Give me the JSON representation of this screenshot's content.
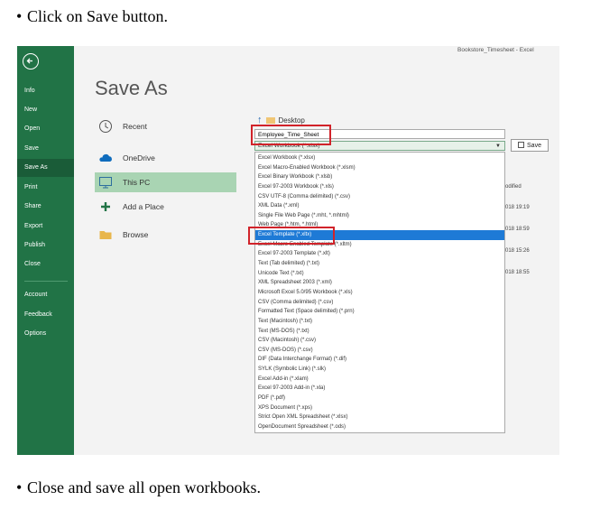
{
  "instructions": {
    "top": "Click on Save button.",
    "bottom": "Close and save all open workbooks.",
    "bullet": "•"
  },
  "window_title": "Bookstore_Timesheet  -  Excel",
  "sidebar": {
    "items": [
      {
        "label": "Info"
      },
      {
        "label": "New"
      },
      {
        "label": "Open"
      },
      {
        "label": "Save"
      },
      {
        "label": "Save As",
        "active": true
      },
      {
        "label": "Print"
      },
      {
        "label": "Share"
      },
      {
        "label": "Export"
      },
      {
        "label": "Publish"
      },
      {
        "label": "Close"
      },
      {
        "label": "Account"
      },
      {
        "label": "Feedback"
      },
      {
        "label": "Options"
      }
    ]
  },
  "page_title": "Save As",
  "locations": [
    {
      "label": "Recent",
      "icon": "clock-icon"
    },
    {
      "label": "OneDrive",
      "icon": "cloud-icon"
    },
    {
      "label": "This PC",
      "icon": "computer-icon",
      "selected": true
    },
    {
      "label": "Add a Place",
      "icon": "plus-icon"
    },
    {
      "label": "Browse",
      "icon": "folder-icon"
    }
  ],
  "path": {
    "label": "Desktop"
  },
  "filename_value": "Employee_Time_Sheet",
  "filetype_selected": "Excel Workbook (*.xlsx)",
  "save_button": "Save",
  "file_types": [
    "Excel Workbook (*.xlsx)",
    "Excel Macro-Enabled Workbook (*.xlsm)",
    "Excel Binary Workbook (*.xlsb)",
    "Excel 97-2003 Workbook (*.xls)",
    "CSV UTF-8 (Comma delimited) (*.csv)",
    "XML Data (*.xml)",
    "Single File Web Page (*.mht, *.mhtml)",
    "Web Page (*.htm, *.html)",
    "Excel Template (*.xltx)",
    "Excel Macro-Enabled Template (*.xltm)",
    "Excel 97-2003 Template (*.xlt)",
    "Text (Tab delimited) (*.txt)",
    "Unicode Text (*.txt)",
    "XML Spreadsheet 2003 (*.xml)",
    "Microsoft Excel 5.0/95 Workbook (*.xls)",
    "CSV (Comma delimited) (*.csv)",
    "Formatted Text (Space delimited) (*.prn)",
    "Text (Macintosh) (*.txt)",
    "Text (MS-DOS) (*.txt)",
    "CSV (Macintosh) (*.csv)",
    "CSV (MS-DOS) (*.csv)",
    "DIF (Data Interchange Format) (*.dif)",
    "SYLK (Symbolic Link) (*.slk)",
    "Excel Add-in (*.xlam)",
    "Excel 97-2003 Add-in (*.xla)",
    "PDF (*.pdf)",
    "XPS Document (*.xps)",
    "Strict Open XML Spreadsheet (*.xlsx)",
    "OpenDocument Spreadsheet (*.ods)"
  ],
  "highlighted_index": 8,
  "behind_text": [
    "odified",
    "018 19:19",
    "018 18:59",
    "018 15:26",
    "018 18:55"
  ],
  "colors": {
    "sidebar": "#217346",
    "highlight": "#1e7ad6",
    "callout": "#d1232a"
  }
}
